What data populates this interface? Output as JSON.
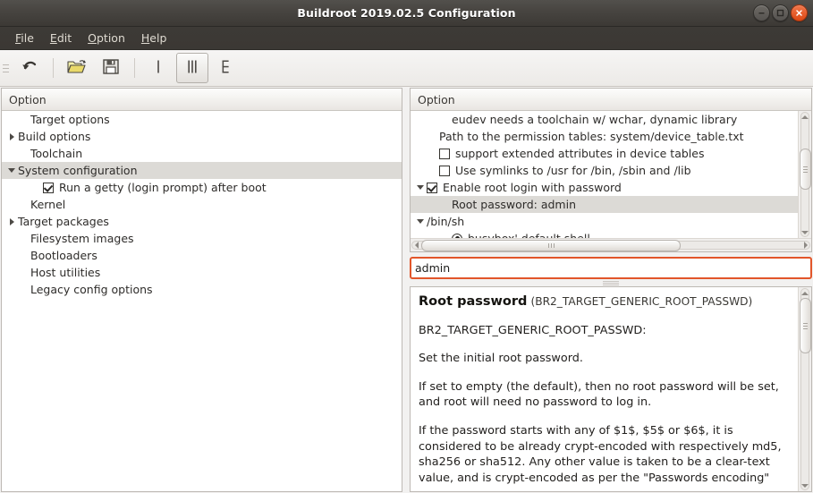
{
  "window": {
    "title": "Buildroot 2019.02.5 Configuration",
    "controls": {
      "minimize": "minimize-button",
      "maximize": "maximize-button",
      "close": "close-button"
    }
  },
  "menubar": {
    "items": [
      {
        "label": "File",
        "mnemonic": "F"
      },
      {
        "label": "Edit",
        "mnemonic": "E"
      },
      {
        "label": "Option",
        "mnemonic": "O"
      },
      {
        "label": "Help",
        "mnemonic": "H"
      }
    ]
  },
  "toolbar": {
    "buttons": [
      {
        "name": "back-button",
        "icon": "undo-arrow-icon",
        "active": false
      },
      {
        "name": "load-button",
        "icon": "open-folder-icon",
        "active": false
      },
      {
        "name": "save-button",
        "icon": "floppy-save-icon",
        "active": false
      },
      {
        "name": "single-view-button",
        "icon": "single-pane-icon",
        "active": false
      },
      {
        "name": "split-view-button",
        "icon": "split-pane-icon",
        "active": true
      },
      {
        "name": "full-view-button",
        "icon": "tree-view-icon",
        "active": false
      }
    ]
  },
  "left_pane": {
    "header": "Option",
    "rows": [
      {
        "label": "Target options",
        "indent": 1,
        "arrow": "none",
        "widget": "none",
        "selected": false
      },
      {
        "label": "Build options",
        "indent": 0,
        "arrow": "right",
        "widget": "none",
        "selected": false
      },
      {
        "label": "Toolchain",
        "indent": 1,
        "arrow": "none",
        "widget": "none",
        "selected": false
      },
      {
        "label": "System configuration",
        "indent": 0,
        "arrow": "down",
        "widget": "none",
        "selected": true
      },
      {
        "label": "Run a getty (login prompt) after boot",
        "indent": 2,
        "arrow": "none",
        "widget": "checkbox-checked",
        "selected": false
      },
      {
        "label": "Kernel",
        "indent": 1,
        "arrow": "none",
        "widget": "none",
        "selected": false
      },
      {
        "label": "Target packages",
        "indent": 0,
        "arrow": "right",
        "widget": "none",
        "selected": false
      },
      {
        "label": "Filesystem images",
        "indent": 1,
        "arrow": "none",
        "widget": "none",
        "selected": false
      },
      {
        "label": "Bootloaders",
        "indent": 1,
        "arrow": "none",
        "widget": "none",
        "selected": false
      },
      {
        "label": "Host utilities",
        "indent": 1,
        "arrow": "none",
        "widget": "none",
        "selected": false
      },
      {
        "label": "Legacy config options",
        "indent": 1,
        "arrow": "none",
        "widget": "none",
        "selected": false
      }
    ]
  },
  "right_pane": {
    "header": "Option",
    "rows": [
      {
        "label": "eudev needs a toolchain w/ wchar, dynamic library",
        "indent": 2,
        "arrow": "none",
        "widget": "none",
        "selected": false
      },
      {
        "label": "Path to the permission tables: system/device_table.txt",
        "indent": 1,
        "arrow": "none",
        "widget": "none",
        "selected": false
      },
      {
        "label": "support extended attributes in device tables",
        "indent": 1,
        "arrow": "none",
        "widget": "checkbox-empty",
        "selected": false
      },
      {
        "label": "Use symlinks to /usr for /bin, /sbin and /lib",
        "indent": 1,
        "arrow": "none",
        "widget": "checkbox-empty",
        "selected": false
      },
      {
        "label": "Enable root login with password",
        "indent": 0,
        "arrow": "down",
        "widget": "checkbox-checked",
        "selected": false
      },
      {
        "label": "Root password: admin",
        "indent": 2,
        "arrow": "none",
        "widget": "none",
        "selected": true
      },
      {
        "label": "/bin/sh",
        "indent": 0,
        "arrow": "down",
        "widget": "none",
        "selected": false
      },
      {
        "label": "busybox' default shell",
        "indent": 2,
        "arrow": "none",
        "widget": "radio-on",
        "selected": false
      }
    ]
  },
  "value_editor": {
    "value": "admin",
    "placeholder": ""
  },
  "help": {
    "title": "Root password",
    "symbol": "(BR2_TARGET_GENERIC_ROOT_PASSWD)",
    "paragraphs": [
      "BR2_TARGET_GENERIC_ROOT_PASSWD:",
      "Set the initial root password.",
      "If set to empty (the default), then no root password will be set, and root will need no password to log in.",
      "If the password starts with any of $1$, $5$ or $6$, it is considered to be already crypt-encoded with respectively md5, sha256 or sha512. Any other value is taken to be a clear-text value, and is crypt-encoded as per the \"Passwords encoding\""
    ]
  },
  "colors": {
    "titlebar_dark": "#3c3935",
    "close_orange": "#dd4814",
    "focus_border": "#e2562a",
    "selection_grey": "#dcdad6",
    "panel_bg": "#f2f1f0"
  }
}
